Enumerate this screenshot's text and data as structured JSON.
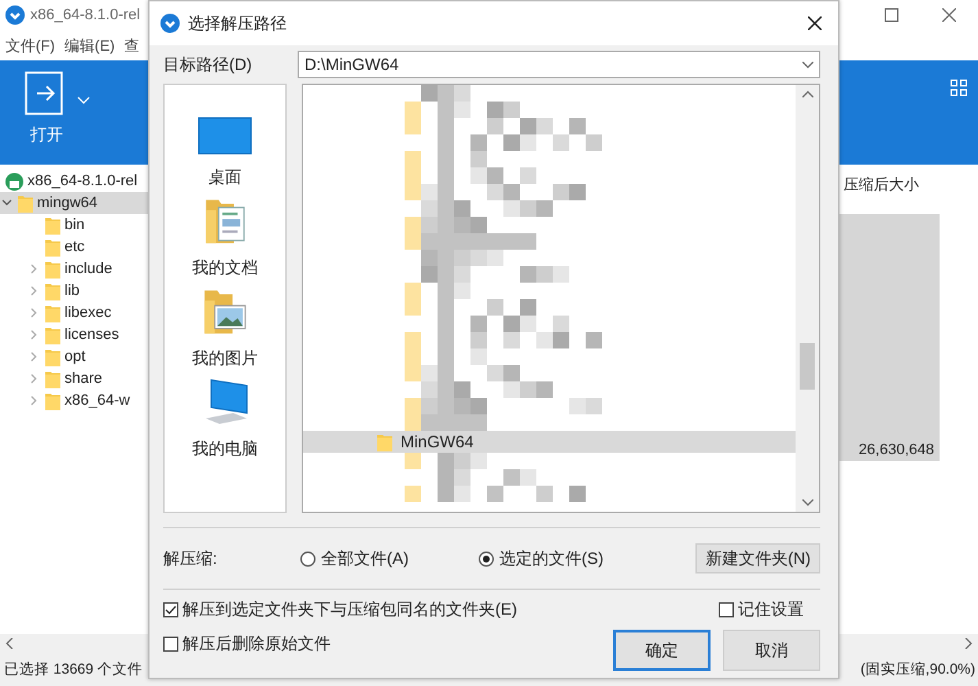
{
  "app": {
    "title": "x86_64-8.1.0-rel",
    "menu": [
      "文件(F)",
      "编辑(E)",
      "查"
    ],
    "toolbar": [
      {
        "label": "打开"
      }
    ],
    "tree": {
      "label": "x86_64-8.1.0-rel",
      "children": [
        {
          "label": "mingw64",
          "expanded": true,
          "selected": true,
          "children": [
            {
              "label": "bin",
              "expandable": false
            },
            {
              "label": "etc",
              "expandable": false
            },
            {
              "label": "include",
              "expandable": true
            },
            {
              "label": "lib",
              "expandable": true
            },
            {
              "label": "libexec",
              "expandable": true
            },
            {
              "label": "licenses",
              "expandable": true
            },
            {
              "label": "opt",
              "expandable": true
            },
            {
              "label": "share",
              "expandable": true
            },
            {
              "label": "x86_64-w",
              "expandable": true
            }
          ]
        }
      ]
    },
    "column_header": "压缩后大小",
    "size_value": "26,630,648",
    "status_left": "已选择 13669 个文件",
    "status_right": "(固实压缩,90.0%)"
  },
  "dialog": {
    "title": "选择解压路径",
    "path_label": "目标路径(D)",
    "path_value": "D:\\MinGW64",
    "places": [
      {
        "kind": "desktop",
        "label": "桌面"
      },
      {
        "kind": "documents",
        "label": "我的文档"
      },
      {
        "kind": "pictures",
        "label": "我的图片"
      },
      {
        "kind": "computer",
        "label": "我的电脑"
      }
    ],
    "folders": [
      {
        "label": "MinGW64",
        "selected": true
      }
    ],
    "extract_label": "解压缩:",
    "radios": [
      {
        "label": "全部文件(A)",
        "selected": false
      },
      {
        "label": "选定的文件(S)",
        "selected": true
      }
    ],
    "new_folder": "新建文件夹(N)",
    "options": [
      {
        "label": "解压到选定文件夹下与压缩包同名的文件夹(E)",
        "checked": true
      },
      {
        "label": "解压后删除原始文件",
        "checked": false
      }
    ],
    "remember": {
      "label": "记住设置",
      "checked": false
    },
    "buttons": [
      {
        "label": "确定",
        "default": true
      },
      {
        "label": "取消",
        "default": false
      }
    ]
  }
}
